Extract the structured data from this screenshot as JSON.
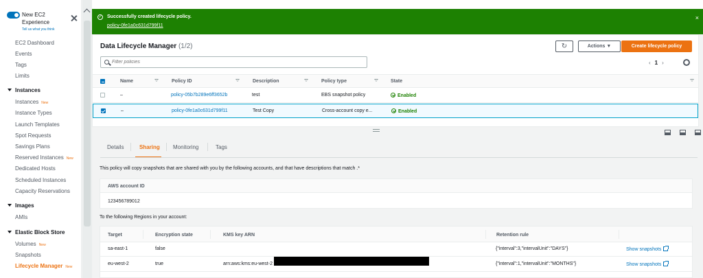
{
  "sidebar": {
    "toggle_label": "New EC2 Experience",
    "tell_us": "Tell us what you think",
    "items": [
      {
        "label": "EC2 Dashboard"
      },
      {
        "label": "Events"
      },
      {
        "label": "Tags"
      },
      {
        "label": "Limits"
      }
    ],
    "sections": [
      {
        "title": "Instances",
        "items": [
          {
            "label": "Instances",
            "badge": "New"
          },
          {
            "label": "Instance Types"
          },
          {
            "label": "Launch Templates"
          },
          {
            "label": "Spot Requests"
          },
          {
            "label": "Savings Plans"
          },
          {
            "label": "Reserved Instances",
            "badge": "New"
          },
          {
            "label": "Dedicated Hosts"
          },
          {
            "label": "Scheduled Instances"
          },
          {
            "label": "Capacity Reservations"
          }
        ]
      },
      {
        "title": "Images",
        "items": [
          {
            "label": "AMIs"
          }
        ]
      },
      {
        "title": "Elastic Block Store",
        "items": [
          {
            "label": "Volumes",
            "badge": "New"
          },
          {
            "label": "Snapshots"
          },
          {
            "label": "Lifecycle Manager",
            "badge": "New"
          }
        ]
      }
    ]
  },
  "flash": {
    "message": "Successfully created lifecycle policy.",
    "link": "policy-0fe1a0c631d799f11",
    "close": "×"
  },
  "panel": {
    "title": "Data Lifecycle Manager",
    "count": "(1/2)",
    "refresh": "↻",
    "actions": "Actions ▼",
    "create": "Create lifecycle policy",
    "filter_placeholder": "Filter policies",
    "pager": {
      "prev": "‹",
      "page": "1",
      "next": "›"
    },
    "columns": [
      "Name",
      "Policy ID",
      "Description",
      "Policy type",
      "State"
    ],
    "rows": [
      {
        "name": "–",
        "policy_id": "policy-05b7b289e6ff3652b",
        "description": "test",
        "policy_type": "EBS snapshot policy",
        "state": "Enabled",
        "selected": false
      },
      {
        "name": "–",
        "policy_id": "policy-0fe1a0c631d799f11",
        "description": "Test Copy",
        "policy_type": "Cross-account copy e...",
        "state": "Enabled",
        "selected": true
      }
    ]
  },
  "details": {
    "tabs": [
      "Details",
      "Sharing",
      "Monitoring",
      "Tags"
    ],
    "active_tab": "Sharing",
    "description": "This policy will copy snapshots that are shared with you by the following accounts, and that have descriptions that match .*",
    "account_header": "AWS account ID",
    "account_id": "123456789012",
    "regions_label": "To the following Regions in your account:",
    "region_columns": [
      "Target",
      "Encryption state",
      "KMS key ARN",
      "Retention rule"
    ],
    "regions": [
      {
        "target": "sa-east-1",
        "encryption": "false",
        "kms": "",
        "retention": "{\"interval\":3,\"intervalUnit\":\"DAYS\"}",
        "link": "Show snapshots"
      },
      {
        "target": "eu-west-2",
        "encryption": "true",
        "kms": "arn:aws:kms:eu-west-2",
        "retention": "{\"interval\":1,\"intervalUnit\":\"MONTHS\"}",
        "link": "Show snapshots"
      }
    ]
  }
}
